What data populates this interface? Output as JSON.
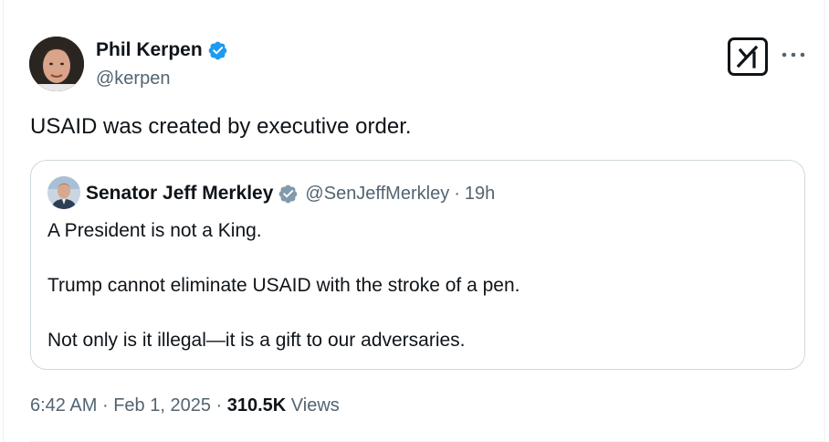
{
  "tweet": {
    "author": {
      "name": "Phil Kerpen",
      "handle": "@kerpen",
      "verified": true
    },
    "text": "USAID was created by executive order.",
    "quoted": {
      "author": {
        "name": "Senator Jeff Merkley",
        "handle": "@SenJeffMerkley",
        "verified": true
      },
      "separator": "·",
      "time": "19h",
      "paragraphs": [
        "A President is not a King.",
        "Trump cannot eliminate USAID with the stroke of a pen.",
        "Not only is it illegal—it is a gift to our adversaries."
      ]
    },
    "meta": {
      "time": "6:42 AM",
      "separator": "·",
      "date": "Feb 1, 2025",
      "separator2": "·",
      "views_count": "310.5K",
      "views_label": "Views"
    }
  },
  "icons": {
    "verified": "verified-badge-icon",
    "grok": "grok-icon",
    "more": "more-options-icon"
  },
  "colors": {
    "verified_blue": "#1d9bf0",
    "verified_gray": "#829aab",
    "text_primary": "#0f1419",
    "text_secondary": "#536471",
    "border": "#cfd9de"
  }
}
